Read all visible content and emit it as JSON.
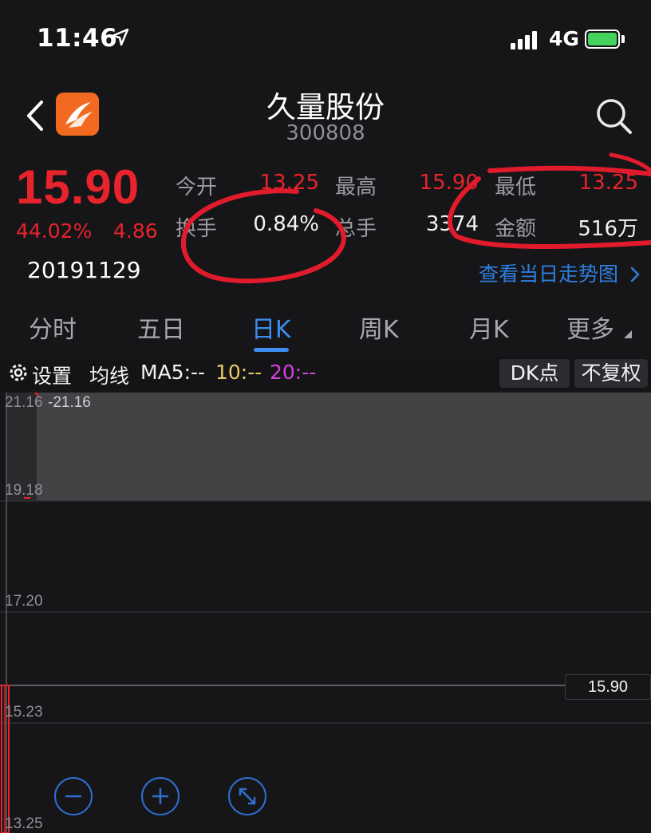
{
  "status_bar": {
    "time": "11:46",
    "network": "4G"
  },
  "header": {
    "stock_name": "久量股份",
    "stock_code": "300808"
  },
  "quote": {
    "price": "15.90",
    "change_pct": "44.02%",
    "change": "4.86",
    "date": "20191129",
    "stats": {
      "open_label": "今开",
      "open_value": "13.25",
      "high_label": "最高",
      "high_value": "15.90",
      "low_label": "最低",
      "low_value": "13.25",
      "turnover_label": "换手",
      "turnover_value": "0.84%",
      "volume_label": "总手",
      "volume_value": "3374",
      "amount_label": "金额",
      "amount_value": "516万"
    },
    "trend_link": "查看当日走势图"
  },
  "tabs": [
    "分时",
    "五日",
    "日K",
    "周K",
    "月K",
    "更多"
  ],
  "active_tab": "日K",
  "toolbar": {
    "settings_label": "设置",
    "ma_label": "均线",
    "ma5": "MA5:--",
    "ma10": "10:--",
    "ma20": "20:--",
    "dk_button": "DK点",
    "adjust_button": "不复权"
  },
  "chart": {
    "y_ticks": [
      "21.16",
      "19.18",
      "17.20",
      "15.23",
      "13.25"
    ],
    "high_marker": "21.16",
    "current_price": "15.90",
    "low_marker": "13.25"
  },
  "colors": {
    "up": "#e7232c",
    "accent": "#3c8ef0",
    "ma10": "#e8c96a",
    "ma20": "#d63fe0"
  }
}
